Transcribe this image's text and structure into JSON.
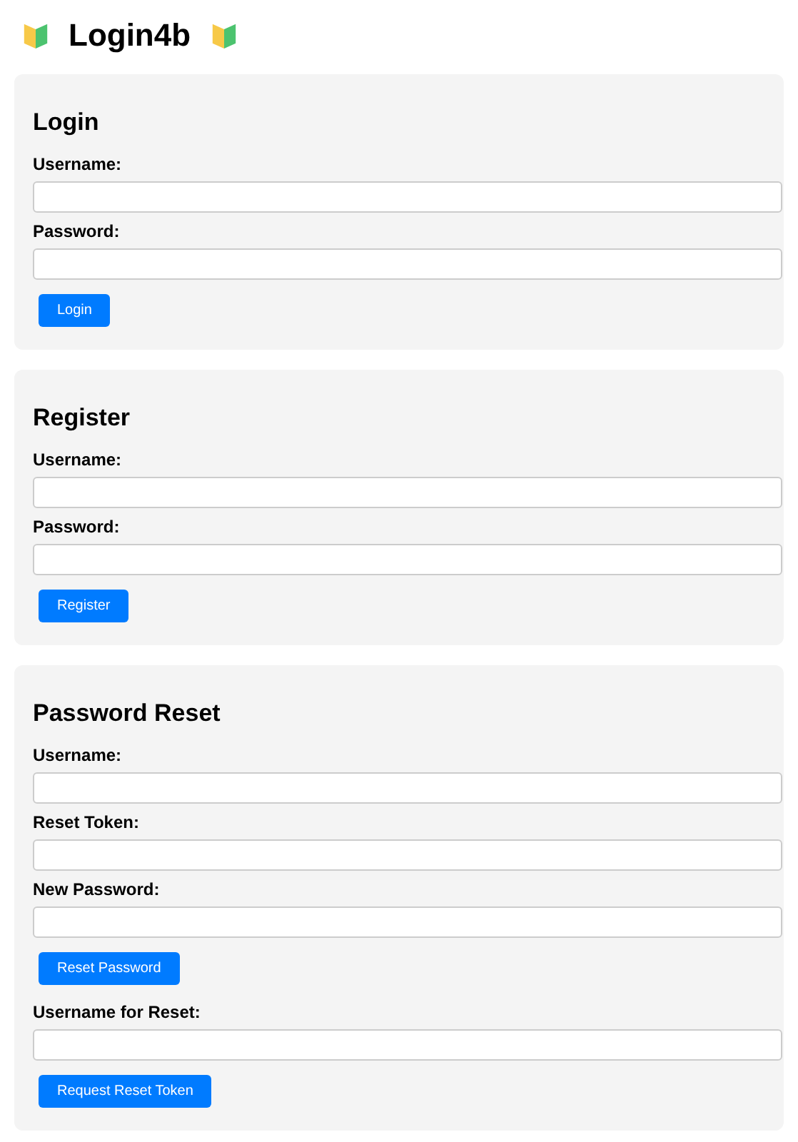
{
  "title": "Login4b",
  "sections": [
    {
      "heading": "Login",
      "items": [
        {
          "kind": "field",
          "label": "Username:"
        },
        {
          "kind": "field",
          "label": "Password:"
        },
        {
          "kind": "button",
          "label": "Login"
        }
      ]
    },
    {
      "heading": "Register",
      "items": [
        {
          "kind": "field",
          "label": "Username:"
        },
        {
          "kind": "field",
          "label": "Password:"
        },
        {
          "kind": "button",
          "label": "Register"
        }
      ]
    },
    {
      "heading": "Password Reset",
      "items": [
        {
          "kind": "field",
          "label": "Username:"
        },
        {
          "kind": "field",
          "label": "Reset Token:"
        },
        {
          "kind": "field",
          "label": "New Password:"
        },
        {
          "kind": "button",
          "label": "Reset Password"
        },
        {
          "kind": "field",
          "label": "Username for Reset:"
        },
        {
          "kind": "button",
          "label": "Request Reset Token"
        }
      ]
    }
  ]
}
